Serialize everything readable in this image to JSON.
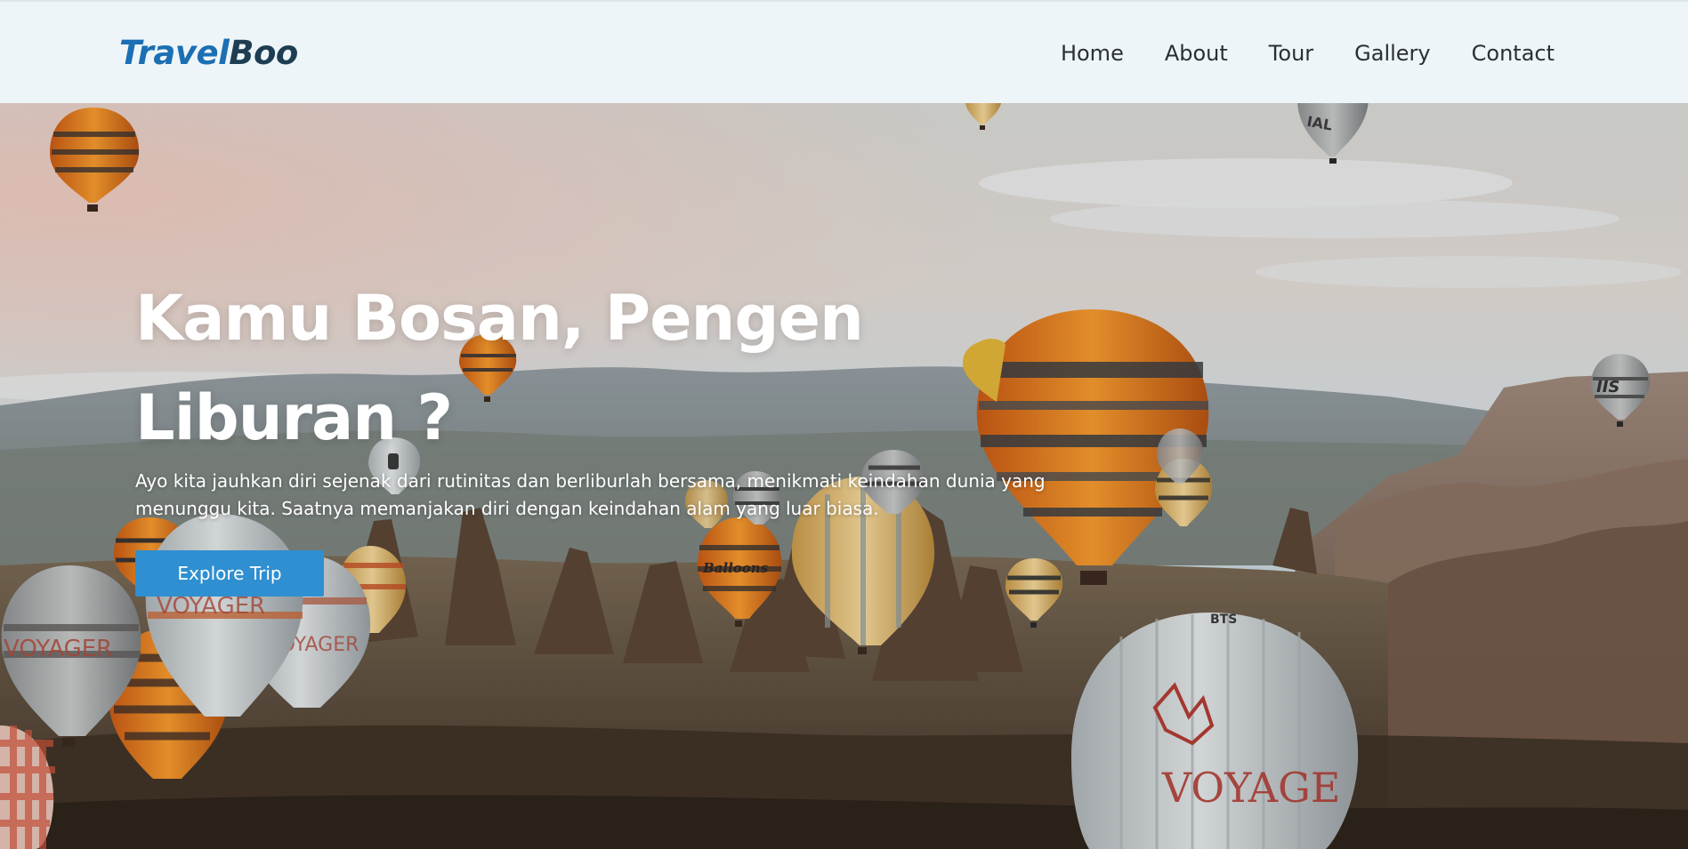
{
  "brand": {
    "part1": "Travel",
    "part2": "Boo"
  },
  "nav": {
    "items": [
      "Home",
      "About",
      "Tour",
      "Gallery",
      "Contact"
    ]
  },
  "hero": {
    "title_line1": "Kamu Bosan, Pengen",
    "title_line2": "Liburan ?",
    "description": "Ayo kita jauhkan diri sejenak dari rutinitas dan berliburlah bersama, menikmati keindahan dunia yang menunggu kita. Saatnya memanjakan diri dengan keindahan alam yang luar biasa.",
    "cta_label": "Explore Trip",
    "background": "hot-air-balloons-landscape-photo",
    "balloon_prints": [
      "VOYAGER",
      "VOYAGER",
      "VOYAGER",
      "VOYAGER",
      "Balloons",
      "IAL",
      "IIS",
      "BTS"
    ]
  },
  "colors": {
    "brand_blue": "#1c6fb3",
    "brand_dark": "#1d3e52",
    "nav_bg": "#eef5f8",
    "cta_bg": "#2f8fd0"
  }
}
